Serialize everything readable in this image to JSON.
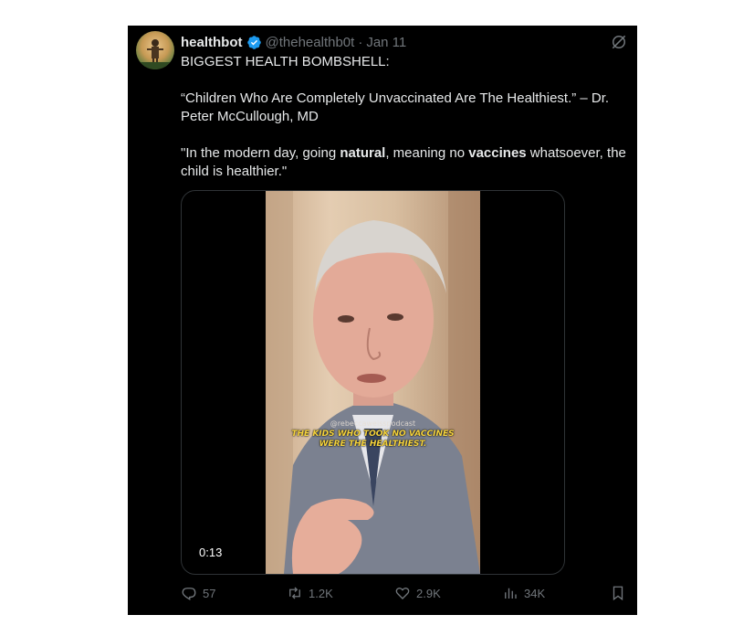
{
  "tweet": {
    "author": {
      "name": "healthbot",
      "handle": "@thehealthb0t",
      "date": "Jan 11",
      "verified_icon": "verified-badge-icon"
    },
    "text": {
      "line1": "BIGGEST HEALTH BOMBSHELL:",
      "quote1": "“Children Who Are Completely Unvaccinated Are The Healthiest.” – Dr. Peter McCullough, MD",
      "quote2_part1": "\"In the modern day, going ",
      "quote2_bold1": "natural",
      "quote2_part2": ", meaning no ",
      "quote2_bold2": "vaccines",
      "quote2_part3": " whatsoever, the child is healthier.\""
    },
    "video": {
      "watermark": "@rebeccaweisspodcast",
      "caption_line1": "THE KIDS WHO TOOK NO VACCINES",
      "caption_line2": "WERE THE HEALTHIEST.",
      "timer": "0:13"
    },
    "actions": {
      "replies": "57",
      "reposts": "1.2K",
      "likes": "2.9K",
      "views": "34K"
    }
  },
  "colors": {
    "background": "#000000",
    "text": "#e7e9ea",
    "muted": "#71767b",
    "verified": "#1d9bf0",
    "caption": "#f5d33d"
  }
}
